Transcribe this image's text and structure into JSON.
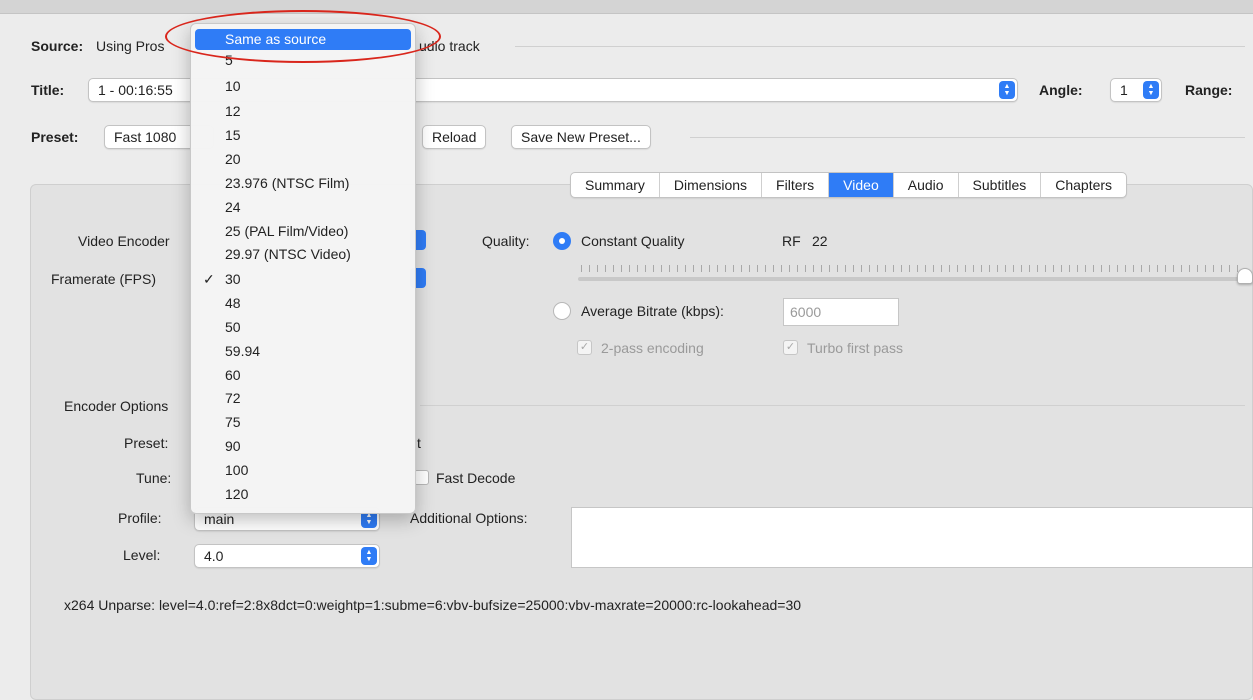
{
  "source": {
    "label": "Source:",
    "value_left": "Using Pros",
    "value_right": "udio track"
  },
  "title_row": {
    "label": "Title:",
    "value": "1 - 00:16:55",
    "angle_label": "Angle:",
    "angle_value": "1",
    "range_label": "Range:"
  },
  "preset_row": {
    "label": "Preset:",
    "value": "Fast 1080",
    "reload": "Reload",
    "save_new": "Save New Preset..."
  },
  "tabs": [
    "Summary",
    "Dimensions",
    "Filters",
    "Video",
    "Audio",
    "Subtitles",
    "Chapters"
  ],
  "active_tab": "Video",
  "video": {
    "encoder_label": "Video Encoder",
    "framerate_label": "Framerate (FPS)",
    "quality_label": "Quality:",
    "constant_quality": "Constant Quality",
    "rf_label": "RF",
    "rf_value": "22",
    "rf_slider_fraction": 0.99,
    "avg_bitrate_label": "Average Bitrate (kbps):",
    "avg_bitrate_value": "6000",
    "two_pass": "2-pass encoding",
    "turbo": "Turbo first pass"
  },
  "encoder_options": {
    "header": "Encoder Options",
    "preset_label": "Preset:",
    "preset_value_tail": "t",
    "tune_label": "Tune:",
    "fast_decode": "Fast Decode",
    "profile_label": "Profile:",
    "profile_value": "main",
    "additional_label": "Additional Options:",
    "level_label": "Level:",
    "level_value": "4.0",
    "unparse": "x264 Unparse: level=4.0:ref=2:8x8dct=0:weightp=1:subme=6:vbv-bufsize=25000:vbv-maxrate=20000:rc-lookahead=30"
  },
  "framerate_menu": {
    "items": [
      "Same as source",
      "5",
      "10",
      "12",
      "15",
      "20",
      "23.976 (NTSC Film)",
      "24",
      "25 (PAL Film/Video)",
      "29.97 (NTSC Video)",
      "30",
      "48",
      "50",
      "59.94",
      "60",
      "72",
      "75",
      "90",
      "100",
      "120"
    ],
    "highlighted": "Same as source",
    "checked": "30",
    "checkmark": "✓"
  },
  "colors": {
    "accent": "#2f7cf6",
    "annotation": "#d9261c"
  }
}
